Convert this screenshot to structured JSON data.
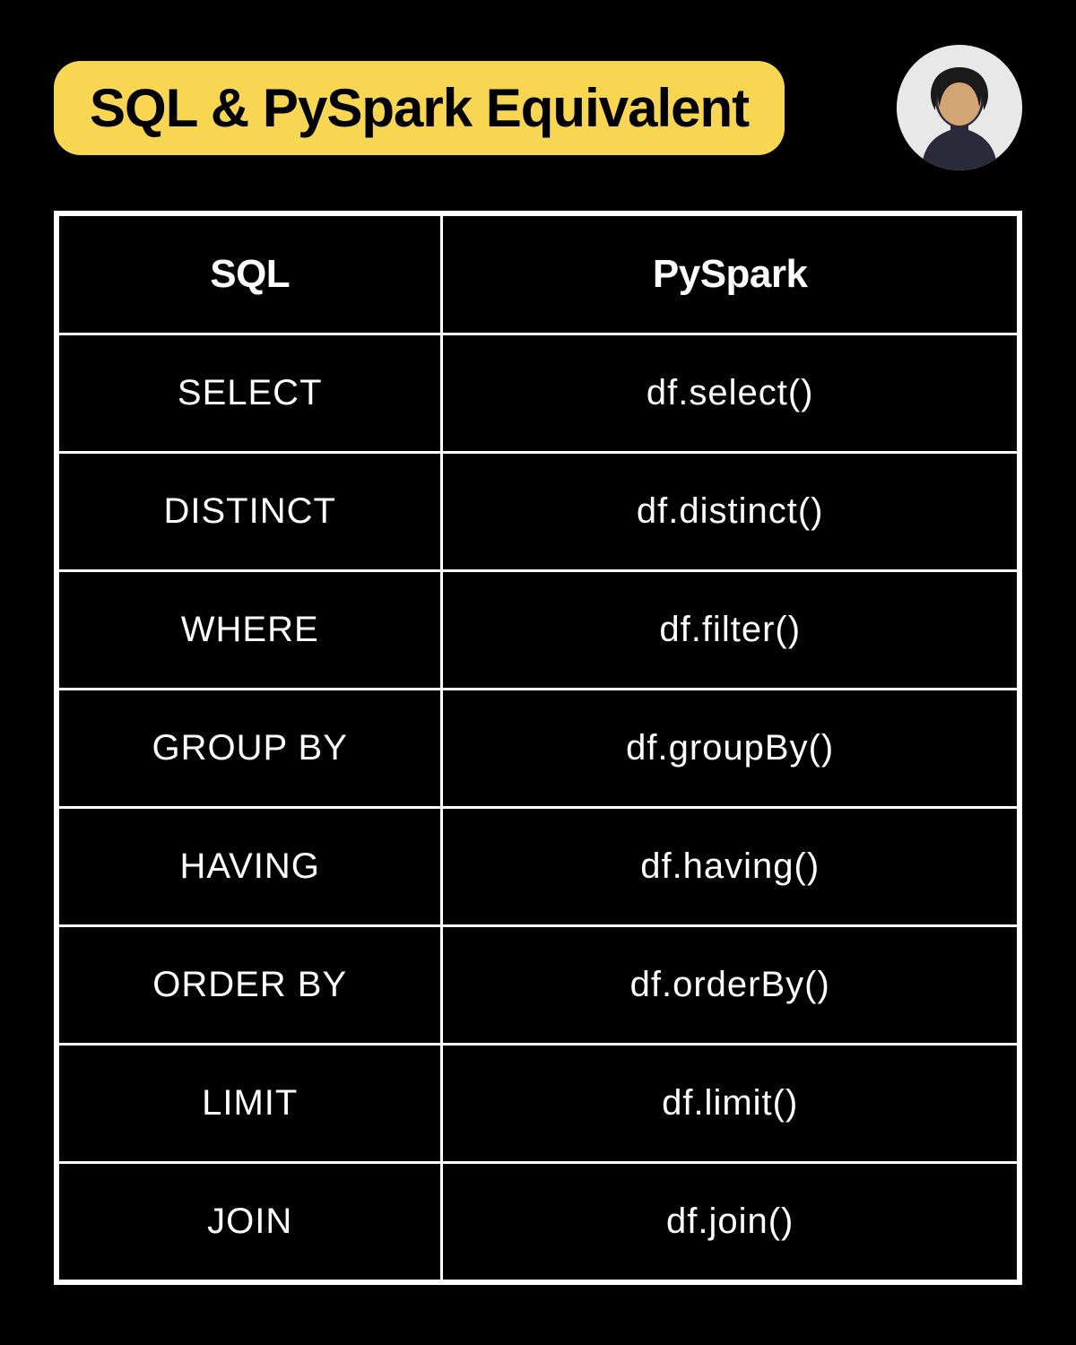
{
  "header": {
    "title": "SQL & PySpark Equivalent"
  },
  "table": {
    "headers": {
      "col1": "SQL",
      "col2": "PySpark"
    },
    "rows": [
      {
        "sql": "SELECT",
        "pyspark": "df.select()"
      },
      {
        "sql": "DISTINCT",
        "pyspark": "df.distinct()"
      },
      {
        "sql": "WHERE",
        "pyspark": "df.filter()"
      },
      {
        "sql": "GROUP BY",
        "pyspark": "df.groupBy()"
      },
      {
        "sql": "HAVING",
        "pyspark": "df.having()"
      },
      {
        "sql": "ORDER BY",
        "pyspark": "df.orderBy()"
      },
      {
        "sql": "LIMIT",
        "pyspark": "df.limit()"
      },
      {
        "sql": "JOIN",
        "pyspark": "df.join()"
      }
    ]
  }
}
